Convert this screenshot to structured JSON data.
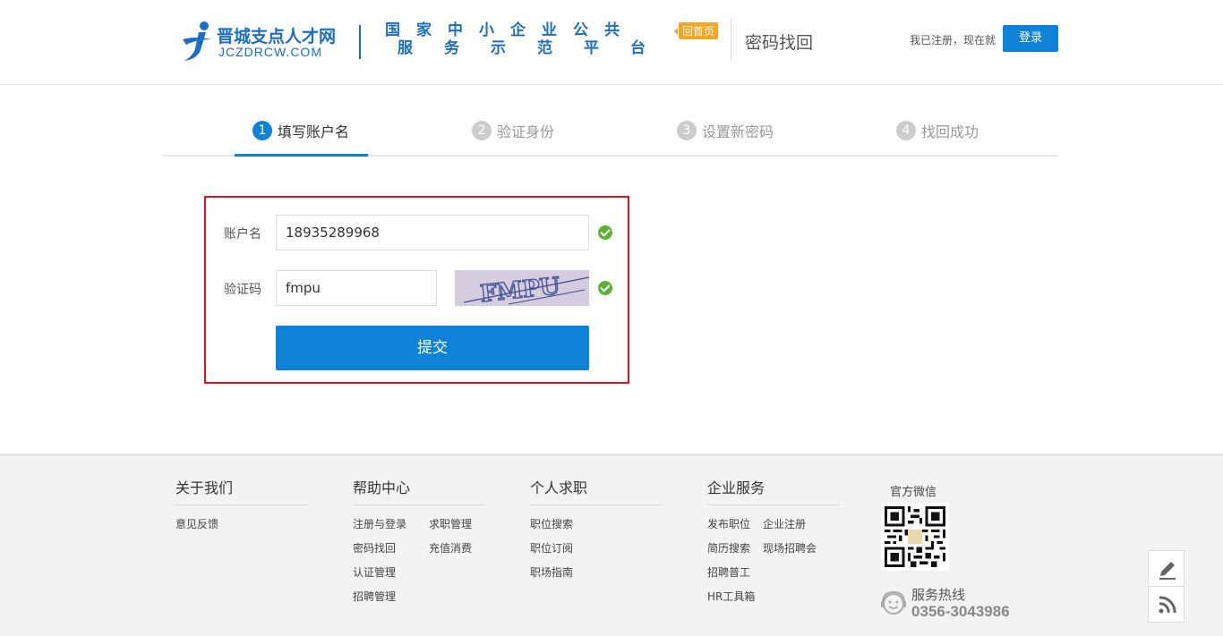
{
  "header": {
    "logo_cn": "晋城支点人才网",
    "logo_en": "JCZDRCW.COM",
    "platform_line1": "国家中小企业公共",
    "platform_line2": "服务示范平台",
    "home_badge": "回首页",
    "page_title": "密码找回",
    "registered_text": "我已注册，现在就",
    "login_label": "登录",
    "brand_color": "#0f82d8"
  },
  "steps": [
    {
      "num": "1",
      "label": "填写账户名",
      "active": true
    },
    {
      "num": "2",
      "label": "验证身份",
      "active": false
    },
    {
      "num": "3",
      "label": "设置新密码",
      "active": false
    },
    {
      "num": "4",
      "label": "找回成功",
      "active": false
    }
  ],
  "form": {
    "account_label": "账户名",
    "account_value": "18935289968",
    "captcha_label": "验证码",
    "captcha_value": "fmpu",
    "captcha_image_text": "FMPU",
    "submit_label": "提交",
    "highlight_color": "#e3121b",
    "success_color": "#5cb532"
  },
  "footer": {
    "columns": [
      {
        "title": "关于我们",
        "links": [
          "意见反馈"
        ]
      },
      {
        "title": "帮助中心",
        "links": [
          "注册与登录",
          "求职管理",
          "密码找回",
          "充值消费",
          "认证管理",
          "招聘管理"
        ]
      },
      {
        "title": "个人求职",
        "links": [
          "职位搜索",
          "职位订阅",
          "职场指南"
        ]
      },
      {
        "title": "企业服务",
        "links": [
          "发布职位",
          "企业注册",
          "简历搜索",
          "现场招聘会",
          "招聘普工",
          "HR工具箱"
        ]
      }
    ],
    "wechat_title": "官方微信",
    "hotline_label": "服务热线",
    "hotline_number": "0356-3043986"
  },
  "side_tools": [
    "edit-icon",
    "rss-icon"
  ]
}
